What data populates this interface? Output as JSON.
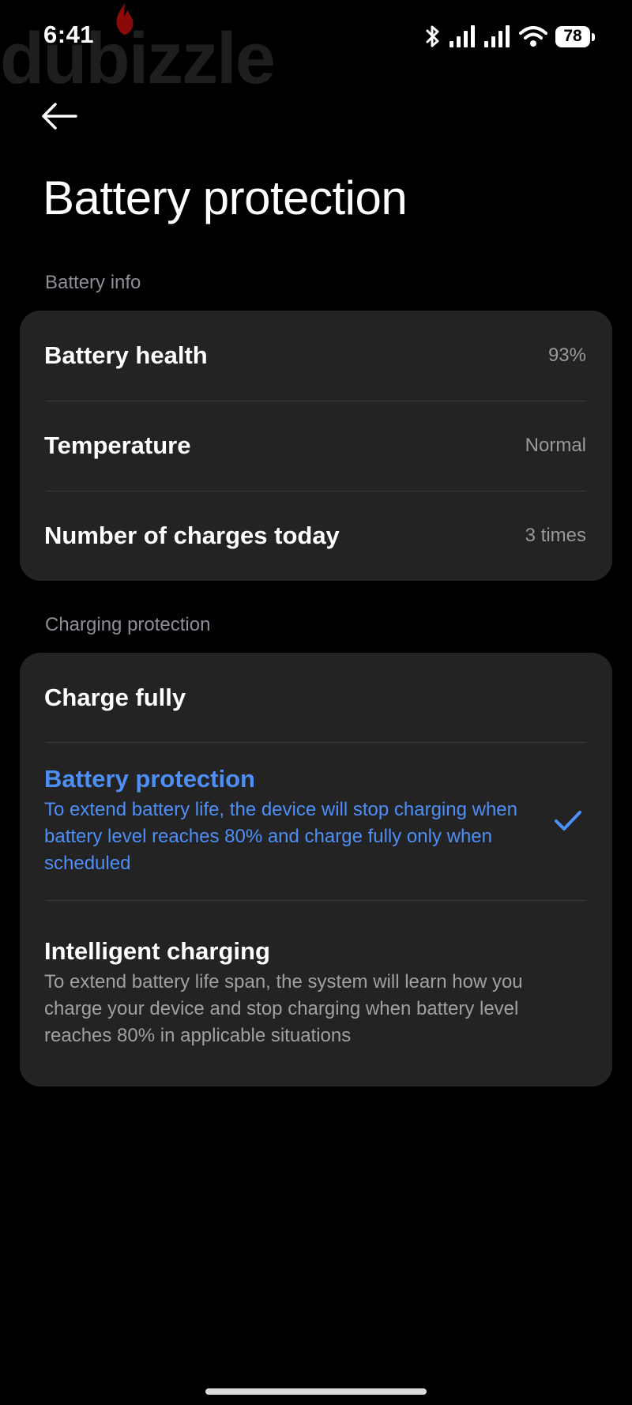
{
  "status_bar": {
    "time": "6:41",
    "battery_level": "78"
  },
  "watermark": {
    "text": "dubizzle"
  },
  "header": {
    "title": "Battery protection"
  },
  "battery_info": {
    "section_label": "Battery info",
    "rows": [
      {
        "label": "Battery health",
        "value": "93%"
      },
      {
        "label": "Temperature",
        "value": "Normal"
      },
      {
        "label": "Number of charges today",
        "value": "3 times"
      }
    ]
  },
  "charging_protection": {
    "section_label": "Charging protection",
    "options": [
      {
        "title": "Charge fully",
        "description": "",
        "selected": false
      },
      {
        "title": "Battery protection",
        "description": "To extend battery life, the device will stop charging when battery level reaches 80% and charge fully only when scheduled",
        "selected": true
      },
      {
        "title": "Intelligent charging",
        "description": "To extend battery life span, the system will learn how you charge your device and stop charging when battery level reaches 80% in applicable situations",
        "selected": false
      }
    ]
  },
  "icons": {
    "back": "arrow-left-icon",
    "bluetooth": "bluetooth-icon",
    "signal": "cellular-signal-icon",
    "wifi": "wifi-icon",
    "check": "checkmark-icon"
  },
  "colors": {
    "background": "#000000",
    "card": "#232323",
    "accent": "#4d8ef7",
    "secondary_text": "#9a9a9a",
    "section_label": "#8e8e99"
  }
}
